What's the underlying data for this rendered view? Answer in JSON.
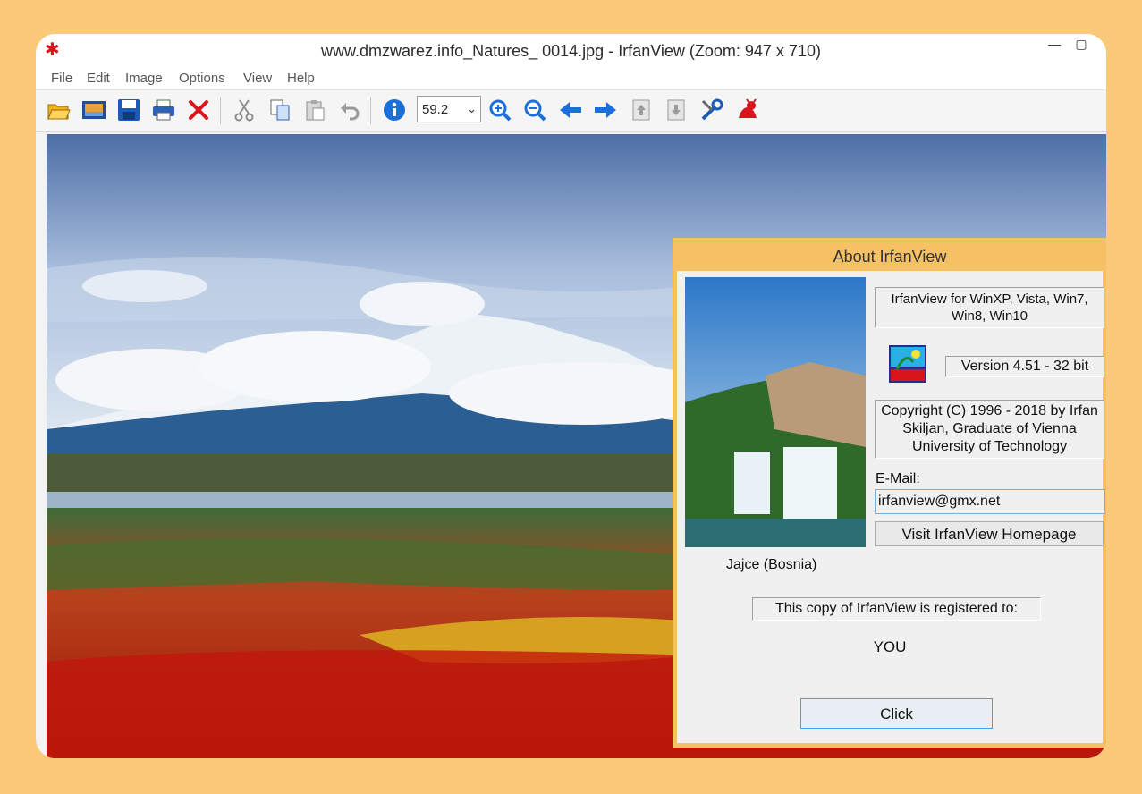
{
  "window": {
    "title": "www.dmzwarez.info_Natures_ 0014.jpg - IrfanView (Zoom: 947 x 710)",
    "app_icon": "irfanview-cat-icon"
  },
  "menu": [
    "File",
    "Edit",
    "Image",
    "Options",
    "View",
    "Help"
  ],
  "toolbar": {
    "buttons": [
      "open-icon",
      "slideshow-icon",
      "save-icon",
      "print-icon",
      "delete-icon",
      "cut-icon",
      "copy-icon",
      "paste-icon",
      "undo-icon",
      "info-icon",
      "zoom-in-icon",
      "zoom-out-icon",
      "previous-icon",
      "next-icon",
      "page-up-icon",
      "page-down-icon",
      "settings-icon",
      "about-icon"
    ],
    "zoom_value": "59.2"
  },
  "about": {
    "title": "About  IrfanView",
    "platforms": "IrfanView for WinXP, Vista, Win7, Win8, Win10",
    "version": "Version 4.51 - 32 bit",
    "copyright": "Copyright (C) 1996 - 2018 by Irfan Skiljan, Graduate of Vienna University of Technology",
    "email_label": "E-Mail:",
    "email_value": "irfanview@gmx.net",
    "homepage_button": "Visit IrfanView Homepage",
    "photo_caption": "Jajce (Bosnia)",
    "registered_label": "This copy of IrfanView is registered to:",
    "registered_to": "YOU",
    "ok_button": "Click"
  },
  "colors": {
    "page_bg": "#fbc97a",
    "dialog_accent": "#f6c164",
    "icon_blue": "#1c6fd8",
    "icon_red": "#d9141a"
  }
}
